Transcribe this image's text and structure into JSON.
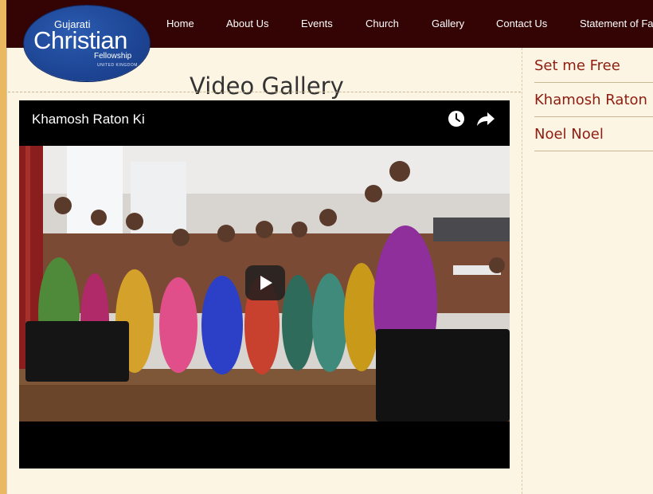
{
  "logo": {
    "line1": "Gujarati",
    "line2": "Christian",
    "line3": "Fellowship",
    "line4": "UNITED KINGDOM"
  },
  "nav": {
    "items": [
      {
        "label": "Home"
      },
      {
        "label": "About Us"
      },
      {
        "label": "Events"
      },
      {
        "label": "Church"
      },
      {
        "label": "Gallery"
      },
      {
        "label": "Contact Us"
      },
      {
        "label": "Statement of Fa"
      }
    ]
  },
  "page": {
    "title": "Video Gallery"
  },
  "video": {
    "title": "Khamosh Raton Ki",
    "icons": [
      "clock-icon",
      "share-icon",
      "play-icon"
    ]
  },
  "sidebar": {
    "items": [
      {
        "label": "Set me Free"
      },
      {
        "label": "Khamosh Raton"
      },
      {
        "label": "Noel Noel"
      }
    ]
  },
  "colors": {
    "nav_bg": "#340404",
    "page_bg": "#fdf5e4",
    "link": "#8e1d10",
    "logo_blue": "#1d4594"
  }
}
